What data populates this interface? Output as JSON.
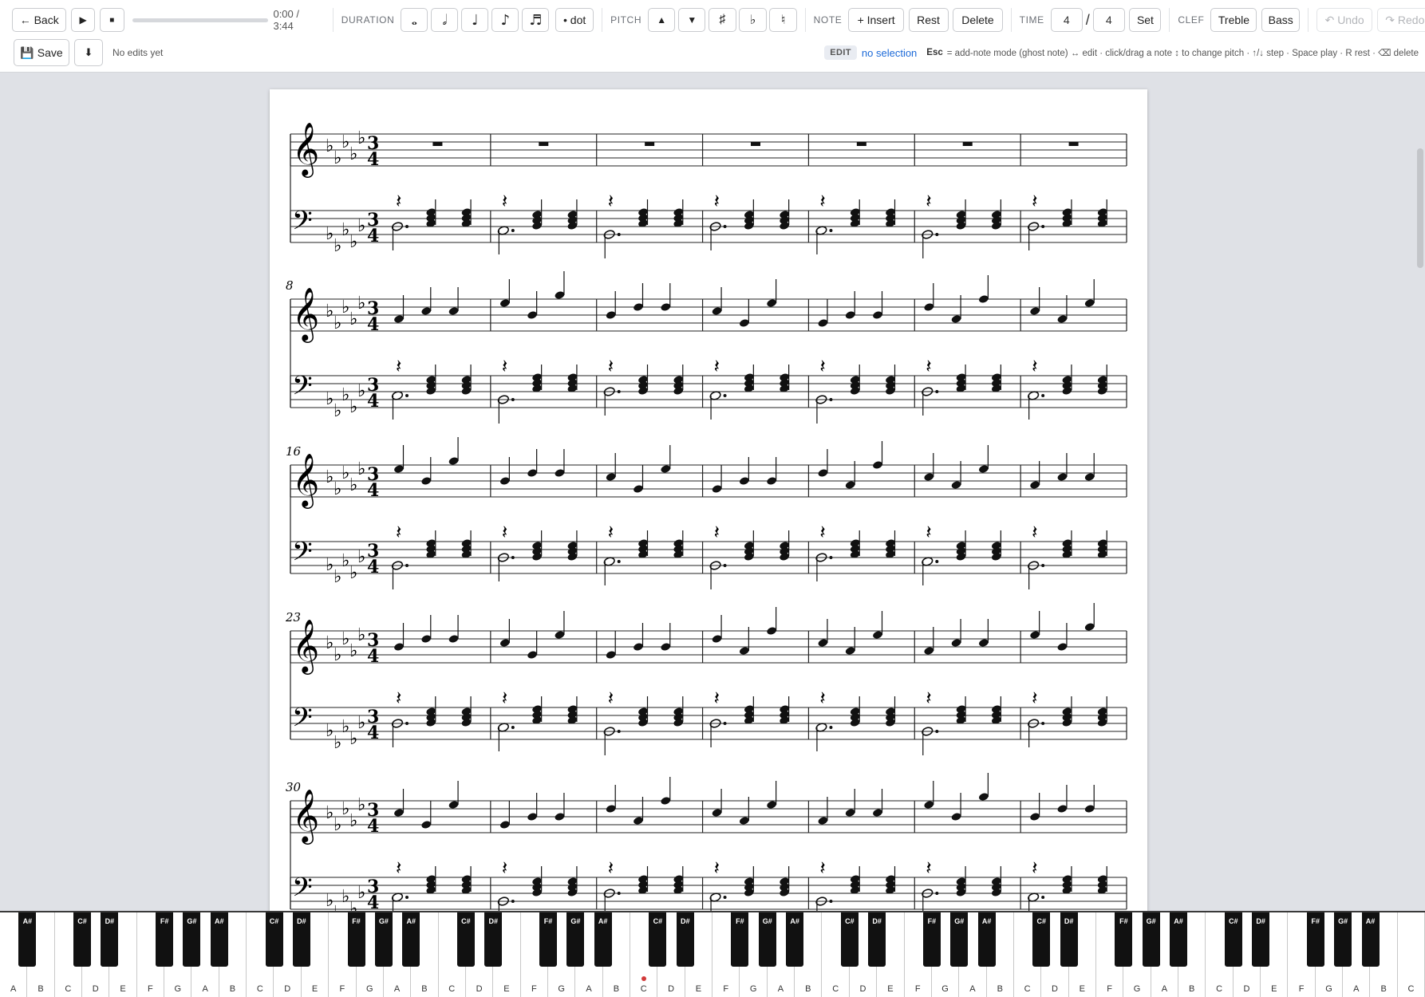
{
  "toolbar": {
    "back_label": "← Back",
    "play_icon": "▶",
    "stop_icon": "■",
    "time_readout": "0:00 / 3:44",
    "duration_label": "DURATION",
    "duration_buttons": [
      {
        "name": "whole-note-icon",
        "glyph": "𝅝"
      },
      {
        "name": "half-note-icon",
        "glyph": "𝅗𝅥"
      },
      {
        "name": "quarter-note-icon",
        "glyph": "♩"
      },
      {
        "name": "eighth-note-icon",
        "glyph": "♪"
      },
      {
        "name": "sixteenth-note-icon",
        "glyph": "♬"
      }
    ],
    "dot_label": "• dot",
    "pitch_label": "PITCH",
    "pitch_up": "▲",
    "pitch_down": "▼",
    "sharp": "♯",
    "flat": "♭",
    "natural": "♮",
    "note_label": "NOTE",
    "insert_label": "+ Insert",
    "rest_label": "Rest",
    "delete_label": "Delete",
    "time_label": "TIME",
    "time_num": "4",
    "time_slash": "/",
    "time_den": "4",
    "set_label": "Set",
    "clef_label": "CLEF",
    "treble_label": "Treble",
    "bass_label": "Bass",
    "undo_label": "↶ Undo",
    "redo_label": "↷ Redo",
    "save_label": "Save",
    "download_icon": "⬇",
    "status_text": "No edits yet",
    "edit_badge": "EDIT",
    "selection_text": "no selection",
    "help_key": "Esc",
    "help_text": "= add-note mode (ghost note) ↔ edit · click/drag a note ↕ to change pitch · ↑/↓ step · Space play · R rest · ⌫ delete"
  },
  "score": {
    "time_signature": {
      "top": "3",
      "bottom": "4"
    },
    "systems": [
      {
        "number": "",
        "measures": 7
      },
      {
        "number": "8",
        "measures": 7
      },
      {
        "number": "16",
        "measures": 7
      },
      {
        "number": "23",
        "measures": 7
      },
      {
        "number": "30",
        "measures": 7
      }
    ]
  },
  "piano": {
    "white_keys": [
      "A",
      "B",
      "C",
      "D",
      "E",
      "F",
      "G",
      "A",
      "B",
      "C",
      "D",
      "E",
      "F",
      "G",
      "A",
      "B",
      "C",
      "D",
      "E",
      "F",
      "G",
      "A",
      "B",
      "C",
      "D",
      "E",
      "F",
      "G",
      "A",
      "B",
      "C",
      "D",
      "E",
      "F",
      "G",
      "A",
      "B",
      "C",
      "D",
      "E",
      "F",
      "G",
      "A",
      "B",
      "C",
      "D",
      "E",
      "F",
      "G",
      "A",
      "B",
      "C"
    ],
    "black_keys": [
      "A#",
      "C#",
      "D#",
      "F#",
      "G#",
      "A#",
      "C#",
      "D#",
      "F#",
      "G#",
      "A#",
      "C#",
      "D#",
      "F#",
      "G#",
      "A#",
      "C#",
      "D#",
      "F#",
      "G#",
      "A#",
      "C#",
      "D#",
      "F#",
      "G#",
      "A#",
      "C#",
      "D#",
      "F#",
      "G#",
      "A#",
      "C#",
      "D#",
      "F#",
      "G#",
      "A#"
    ],
    "middle_c_index": 23
  }
}
